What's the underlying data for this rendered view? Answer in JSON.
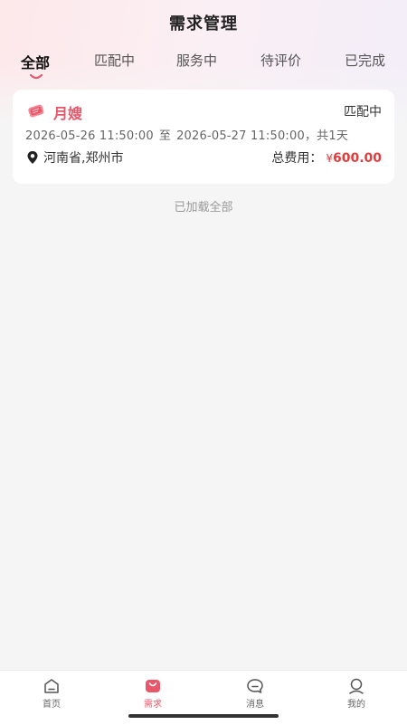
{
  "header": {
    "title": "需求管理"
  },
  "tabs": [
    {
      "label": "全部",
      "active": true
    },
    {
      "label": "匹配中",
      "active": false
    },
    {
      "label": "服务中",
      "active": false
    },
    {
      "label": "待评价",
      "active": false
    },
    {
      "label": "已完成",
      "active": false
    }
  ],
  "orders": [
    {
      "service": "月嫂",
      "service_icon": "tag-icon",
      "status": "匹配中",
      "start_time": "2026-05-26 11:50:00",
      "separator": "至",
      "end_time": "2026-05-27 11:50:00",
      "duration": "，共1天",
      "location": "河南省,郑州市",
      "fee_label": "总费用：",
      "currency": "¥",
      "amount": "600.00"
    }
  ],
  "list_footer": "已加载全部",
  "tabbar": {
    "items": [
      {
        "label": "首页",
        "icon": "home-icon",
        "active": false
      },
      {
        "label": "需求",
        "icon": "bag-icon",
        "active": true
      },
      {
        "label": "消息",
        "icon": "chat-bubble-icon",
        "active": false
      },
      {
        "label": "我的",
        "icon": "user-icon",
        "active": false
      }
    ]
  },
  "colors": {
    "accent": "#e9566a",
    "price": "#e23c3c",
    "background": "#f5f5f5"
  }
}
